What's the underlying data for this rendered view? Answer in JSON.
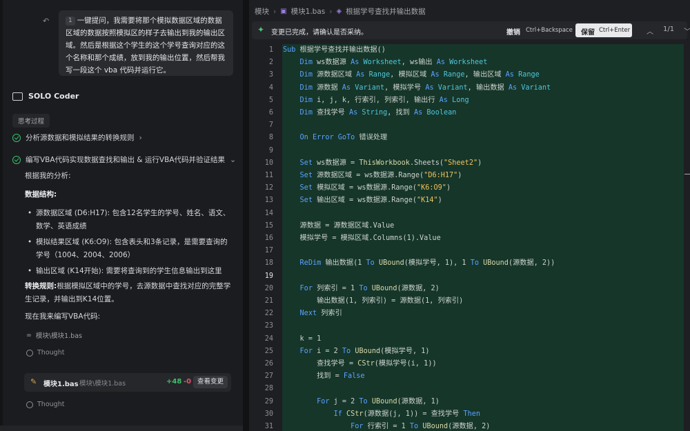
{
  "chat": {
    "undo_icon": "undo-icon",
    "user_message": {
      "file_chip": "1",
      "text": "一键提问，我需要将那个模拟数据区域的数据区域的数据按照模拟区的样子去输出到我的输出区域。然后是根据这个学生的这个学号查询对应的这个名称和那个成绩，放到我的输出位置，然后帮我写一段这个 vba 代码并运行它。"
    },
    "agent_name": "SOLO Coder",
    "thinking_label": "思考过程",
    "steps": [
      {
        "label": "分析源数据和模拟结果的转换规则",
        "chevron": "›"
      },
      {
        "label": "编写VBA代码实现数据查找和输出 & 运行VBA代码并验证结果",
        "chevron": "⌄"
      }
    ],
    "analysis_intro": "根据我的分析:",
    "structure_heading": "数据结构:",
    "bullets": [
      "源数据区域 (D6:H17): 包含12名学生的学号、姓名、语文、数学、英语成绩",
      "模拟结果区域 (K6:O9): 包含表头和3条记录，是需要查询的学号（1004、2004、2006）",
      "输出区域 (K14开始): 需要将查询到的学生信息输出到这里"
    ],
    "rule_heading": "转换规则:",
    "rule_text": "根据模拟区域中的学号，去源数据中查找对应的完整学生记录，并输出到K14位置。",
    "now_writing": "现在我来编写VBA代码:",
    "file_link": "模块\\模块1.bas",
    "thought_label": "Thought",
    "file_card": {
      "name": "模块1.bas",
      "path": "模块\\模块1.bas",
      "added": "+48",
      "removed": "-0",
      "button": "查看变更"
    }
  },
  "editor": {
    "breadcrumb": [
      "模块",
      "模块1.bas",
      "根据学号查找并输出数据"
    ],
    "notification": {
      "message": "变更已完成，请确认是否采纳。",
      "undo_label": "撤销",
      "undo_shortcut": "Ctrl+Backspace",
      "keep_label": "保留",
      "keep_shortcut": "Ctrl+Enter",
      "page": "1/1"
    },
    "current_line": 19,
    "lines": [
      {
        "n": "1",
        "html": "<span class=\"kw\">Sub</span> 根据学号查找并输出数据()"
      },
      {
        "n": "2",
        "html": "    <span class=\"kw\">Dim</span> ws数据源 <span class=\"kw\">As</span> <span class=\"ty\">Worksheet</span>, ws输出 <span class=\"kw\">As</span> <span class=\"ty\">Worksheet</span>"
      },
      {
        "n": "3",
        "html": "    <span class=\"kw\">Dim</span> 源数据区域 <span class=\"kw\">As</span> <span class=\"ty\">Range</span>, 模拟区域 <span class=\"kw\">As</span> <span class=\"ty\">Range</span>, 输出区域 <span class=\"kw\">As</span> <span class=\"ty\">Range</span>"
      },
      {
        "n": "4",
        "html": "    <span class=\"kw\">Dim</span> 源数据 <span class=\"kw\">As</span> <span class=\"ty\">Variant</span>, 模拟学号 <span class=\"kw\">As</span> <span class=\"ty\">Variant</span>, 输出数据 <span class=\"kw\">As</span> <span class=\"ty\">Variant</span>"
      },
      {
        "n": "5",
        "html": "    <span class=\"kw\">Dim</span> i, j, k, 行索引, 列索引, 输出行 <span class=\"kw\">As</span> <span class=\"ty\">Long</span>"
      },
      {
        "n": "6",
        "html": "    <span class=\"kw\">Dim</span> 查找学号 <span class=\"kw\">As</span> <span class=\"ty\">String</span>, 找到 <span class=\"kw\">As</span> <span class=\"ty\">Boolean</span>"
      },
      {
        "n": "7",
        "html": ""
      },
      {
        "n": "8",
        "html": "    <span class=\"kw\">On Error GoTo</span> 错误处理"
      },
      {
        "n": "9",
        "html": ""
      },
      {
        "n": "10",
        "html": "    <span class=\"kw\">Set</span> ws数据源 = <span class=\"fn\">ThisWorkbook</span>.Sheets(<span class=\"st\">\"Sheet2\"</span>)"
      },
      {
        "n": "11",
        "html": "    <span class=\"kw\">Set</span> 源数据区域 = ws数据源.Range(<span class=\"st\">\"D6:H17\"</span>)"
      },
      {
        "n": "12",
        "html": "    <span class=\"kw\">Set</span> 模拟区域 = ws数据源.Range(<span class=\"st\">\"K6:O9\"</span>)"
      },
      {
        "n": "13",
        "html": "    <span class=\"kw\">Set</span> 输出区域 = ws数据源.Range(<span class=\"st\">\"K14\"</span>)"
      },
      {
        "n": "14",
        "html": ""
      },
      {
        "n": "15",
        "html": "    源数据 = 源数据区域.Value"
      },
      {
        "n": "16",
        "html": "    模拟学号 = 模拟区域.Columns(1).Value"
      },
      {
        "n": "17",
        "html": ""
      },
      {
        "n": "18",
        "html": "    <span class=\"kw\">ReDim</span> 输出数据(1 <span class=\"kw\">To</span> <span class=\"fn\">UBound</span>(模拟学号, 1), 1 <span class=\"kw\">To</span> <span class=\"fn\">UBound</span>(源数据, 2))"
      },
      {
        "n": "19",
        "html": ""
      },
      {
        "n": "20",
        "html": "    <span class=\"kw\">For</span> 列索引 = 1 <span class=\"kw\">To</span> <span class=\"fn\">UBound</span>(源数据, 2)"
      },
      {
        "n": "21",
        "html": "        输出数据(1, 列索引) = 源数据(1, 列索引)"
      },
      {
        "n": "22",
        "html": "    <span class=\"kw\">Next</span> 列索引"
      },
      {
        "n": "23",
        "html": ""
      },
      {
        "n": "24",
        "html": "    k = 1"
      },
      {
        "n": "25",
        "html": "    <span class=\"kw\">For</span> i = 2 <span class=\"kw\">To</span> <span class=\"fn\">UBound</span>(模拟学号, 1)"
      },
      {
        "n": "26",
        "html": "        查找学号 = <span class=\"fn\">CStr</span>(模拟学号(i, 1))"
      },
      {
        "n": "27",
        "html": "        找到 = <span class=\"kw\">False</span>"
      },
      {
        "n": "28",
        "html": ""
      },
      {
        "n": "29",
        "html": "        <span class=\"kw\">For</span> j = 2 <span class=\"kw\">To</span> <span class=\"fn\">UBound</span>(源数据, 1)"
      },
      {
        "n": "30",
        "html": "            <span class=\"kw\">If</span> <span class=\"fn\">CStr</span>(源数据(j, 1)) = 查找学号 <span class=\"kw\">Then</span>"
      },
      {
        "n": "31",
        "html": "                <span class=\"kw\">For</span> 行索引 = 1 <span class=\"kw\">To</span> <span class=\"fn\">UBound</span>(源数据, 2)"
      }
    ]
  }
}
